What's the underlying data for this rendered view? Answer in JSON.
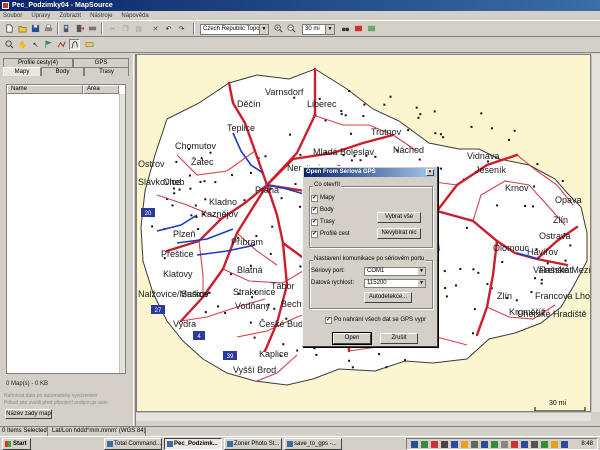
{
  "window": {
    "title": "Pec_Podzimky04 - MapSource"
  },
  "menu": [
    "Soubor",
    "Úpravy",
    "Zobrazit",
    "Nástroje",
    "Nápověda"
  ],
  "toolbar": {
    "map_product": "Czech Republic Topo",
    "zoom_level": "30 mi"
  },
  "left_panel": {
    "tabs_top": [
      "Profile cesty(4)",
      "GPS"
    ],
    "tabs_bottom": [
      "Mapy",
      "Body",
      "Trasy"
    ],
    "active_tab": "Mapy",
    "columns": [
      "Name",
      "Area"
    ],
    "maps_summary": "0 Map(s) - 0 KB",
    "hint_line1": "Nahrávat data po automaticky vyvozeném",
    "hint_line2": "Pokud jste zvolili před připojení podporuje auto",
    "show_maps_button": "Název zady map"
  },
  "map": {
    "cities": [
      {
        "name": "Varnsdorf"
      },
      {
        "name": "Děčín"
      },
      {
        "name": "Liberec"
      },
      {
        "name": "Teplice"
      },
      {
        "name": "Trutnov"
      },
      {
        "name": "Chomutov"
      },
      {
        "name": "Mladá Boleslav"
      },
      {
        "name": "Náchod"
      },
      {
        "name": "Vidnava"
      },
      {
        "name": "Ostrov"
      },
      {
        "name": "Žatec"
      },
      {
        "name": "Neratovice"
      },
      {
        "name": "Jeseník"
      },
      {
        "name": "Cheb"
      },
      {
        "name": "Slavkovice"
      },
      {
        "name": "Kolín"
      },
      {
        "name": "Krnov"
      },
      {
        "name": "Praha"
      },
      {
        "name": "Kladno"
      },
      {
        "name": "Opava"
      },
      {
        "name": "Zlín"
      },
      {
        "name": "Žďár"
      },
      {
        "name": "Kutná Hora"
      },
      {
        "name": "Ostrava"
      },
      {
        "name": "Kaznějov"
      },
      {
        "name": "Olomouc"
      },
      {
        "name": "Plzeň"
      },
      {
        "name": "Příbram"
      },
      {
        "name": "Havířov"
      },
      {
        "name": "Přeštice"
      },
      {
        "name": "Frenštát"
      },
      {
        "name": "Klatovy"
      },
      {
        "name": "Blatná"
      },
      {
        "name": "Tábor"
      },
      {
        "name": "Valašské Meziříčí"
      },
      {
        "name": "Nalžovice/Markov"
      },
      {
        "name": "Sušice"
      },
      {
        "name": "Strakonice"
      },
      {
        "name": "Bechyně"
      },
      {
        "name": "Zlín"
      },
      {
        "name": "Francova Lhota"
      },
      {
        "name": "Vodňany"
      },
      {
        "name": "Kroměříž"
      },
      {
        "name": "Vydra"
      },
      {
        "name": "České Budějovice"
      },
      {
        "name": "Uherské Hradiště"
      },
      {
        "name": "Kaplice"
      },
      {
        "name": "Vyšší Brod"
      }
    ],
    "route_shields": [
      "20",
      "27",
      "4",
      "39"
    ],
    "scale": "30 mi"
  },
  "dialog": {
    "title": "Open From Sériová GPS",
    "close": "×",
    "group_open": "Co otevřít",
    "check_maps": "Mapy",
    "check_points": "Body",
    "check_tracks": "Trasy",
    "check_profile": "Profilé cest",
    "btn_select_all": "Vybrat vše",
    "btn_select_none": "Nevybírat nic",
    "group_port": "Nastavení komunikace po sériovém portu",
    "label_port": "Sériový port:",
    "port_value": "COM1",
    "label_speed": "Datová rychlost:",
    "speed_value": "115200",
    "btn_autodetect": "Autodetekce...",
    "check_gps_off": "Po nahrání všech dat se GPS vypr",
    "btn_open": "Open",
    "btn_cancel": "Zrušit"
  },
  "status": {
    "selection": "0 Items Selected",
    "coords": "Lat/Lon hddd°mm.mmm' (WGS 84)"
  },
  "taskbar": {
    "start": "Start",
    "items": [
      "Total Command...",
      "Pec_Podzimk...",
      "Zoner Photo St...",
      "save_to_gps -..."
    ],
    "active_index": 1,
    "clock": "8:48"
  },
  "colors": {
    "title_start": "#0a246a",
    "title_end": "#3a6ea5",
    "road_major": "#cc1f2e",
    "river": "#1a3fb8",
    "map_background": "#ffffff",
    "outside_country": "#fbf6cf"
  },
  "icons": [
    "app-icon",
    "new-icon",
    "open-icon",
    "save-icon",
    "print-icon",
    "gps-receive-icon",
    "gps-send-icon",
    "undo-icon",
    "zoom-in-icon",
    "zoom-out-icon",
    "binoculars-icon",
    "hand-icon",
    "select-icon",
    "waypoint-icon",
    "route-icon",
    "track-icon",
    "distance-icon"
  ]
}
